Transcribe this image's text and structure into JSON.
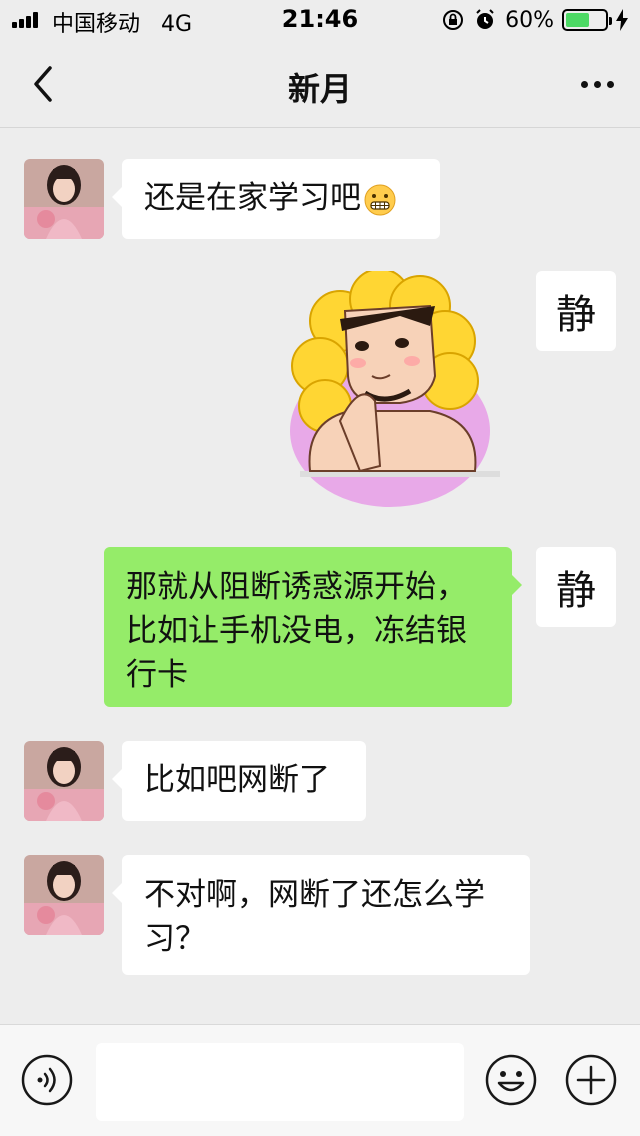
{
  "status_bar": {
    "carrier": "中国移动",
    "network": "4G",
    "time": "21:46",
    "battery_percent": "60%",
    "battery_level": 0.6
  },
  "nav": {
    "title": "新月",
    "back_icon": "chevron-left-icon",
    "more_icon": "ellipsis-icon"
  },
  "messages": [
    {
      "sender": "other",
      "text": "还是在家学习吧",
      "emoji": "grimace-emoji"
    },
    {
      "sender": "self",
      "type": "sticker",
      "sticker": "sunflower-man-sticker"
    },
    {
      "sender": "self",
      "text_lines": [
        "那就从阻断诱惑源开始，",
        "比如让手机没电，冻结银",
        "行卡"
      ]
    },
    {
      "sender": "other",
      "text": "比如吧网断了"
    },
    {
      "sender": "other",
      "text_lines": [
        "不对啊，网断了还怎么学",
        "习？"
      ]
    }
  ],
  "self_avatar_char": "静",
  "input_bar": {
    "voice_icon": "voice-icon",
    "emoji_icon": "smiley-icon",
    "plus_icon": "plus-circle-icon",
    "input_value": ""
  },
  "colors": {
    "background": "#ededed",
    "self_bubble": "#95ec69",
    "other_bubble": "#ffffff",
    "battery": "#4cd964"
  }
}
